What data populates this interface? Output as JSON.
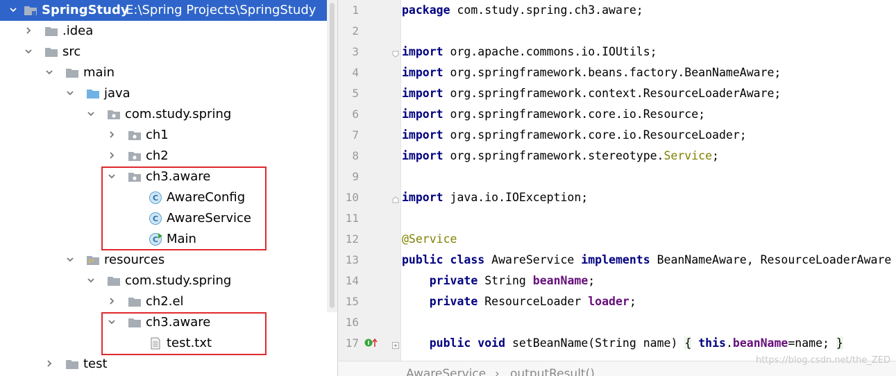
{
  "project_tree": {
    "root": {
      "name": "SpringStudy",
      "path": "E:\\Spring Projects\\SpringStudy"
    },
    "items": [
      {
        "label": "SpringStudy"
      },
      {
        "label": ".idea"
      },
      {
        "label": "src"
      },
      {
        "label": "main"
      },
      {
        "label": "java"
      },
      {
        "label": "com.study.spring"
      },
      {
        "label": "ch1"
      },
      {
        "label": "ch2"
      },
      {
        "label": "ch3.aware"
      },
      {
        "label": "AwareConfig"
      },
      {
        "label": "AwareService"
      },
      {
        "label": "Main"
      },
      {
        "label": "resources"
      },
      {
        "label": "com.study.spring"
      },
      {
        "label": "ch2.el"
      },
      {
        "label": "ch3.aware"
      },
      {
        "label": "test.txt"
      },
      {
        "label": "test"
      }
    ]
  },
  "editor": {
    "line_numbers": [
      "1",
      "2",
      "3",
      "4",
      "5",
      "6",
      "7",
      "8",
      "9",
      "10",
      "11",
      "12",
      "13",
      "14",
      "15",
      "16",
      "17"
    ],
    "code": {
      "l1_kw": "package",
      "l1_rest": " com.study.spring.ch3.aware;",
      "l3_kw": "import",
      "l3_rest": " org.apache.commons.io.IOUtils;",
      "l4_kw": "import",
      "l4_rest": " org.springframework.beans.factory.BeanNameAware;",
      "l5_kw": "import",
      "l5_rest": " org.springframework.context.ResourceLoaderAware;",
      "l6_kw": "import",
      "l6_rest": " org.springframework.core.io.Resource;",
      "l7_kw": "import",
      "l7_rest": " org.springframework.core.io.ResourceLoader;",
      "l8_kw": "import",
      "l8_rest": " org.springframework.stereotype.",
      "l8_ann": "Service",
      "l8_end": ";",
      "l10_kw": "import",
      "l10_rest": " java.io.IOException;",
      "l12_ann": "@Service",
      "l13_kw1": "public",
      "l13_kw2": "class",
      "l13_name": " AwareService ",
      "l13_kw3": "implements",
      "l13_rest": " BeanNameAware, ResourceLoaderAware {",
      "l14_kw": "private",
      "l14_type": " String ",
      "l14_field": "beanName",
      "l14_end": ";",
      "l15_kw": "private",
      "l15_type": " ResourceLoader ",
      "l15_field": "loader",
      "l15_end": ";",
      "l17_kw1": "public",
      "l17_kw2": "void",
      "l17_sig": " setBeanName(String name) ",
      "l17_open": "{",
      "l17_this": "this",
      "l17_dot": ".",
      "l17_field": "beanName",
      "l17_assign": "=name; ",
      "l17_close": "}"
    }
  },
  "breadcrumb": {
    "item1": "AwareService",
    "sep": "›",
    "item2": "outputResult()"
  },
  "watermark": "https://blog.csdn.net/the_ZED",
  "colors": {
    "selection": "#2f65ca",
    "highlight_box": "#e0282e",
    "keyword": "#000080",
    "annotation": "#808000",
    "field": "#660e7a"
  }
}
